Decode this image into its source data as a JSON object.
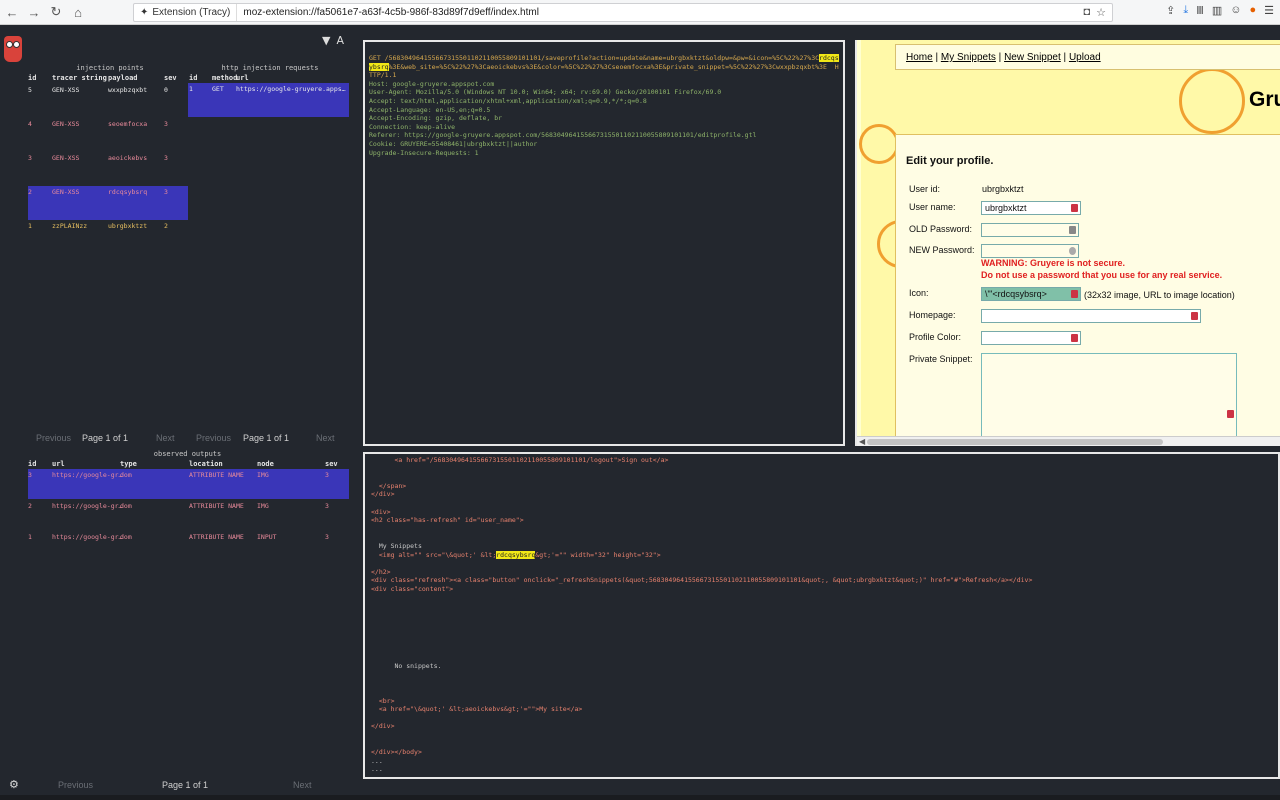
{
  "browser": {
    "identity": "Extension (Tracy)",
    "url": "moz-extension://fa5061e7-a63f-4c5b-986f-83d89f7d9eff/index.html"
  },
  "injection": {
    "title": "injection points",
    "headers": [
      "id",
      "tracer string",
      "payload",
      "sev"
    ],
    "rows": [
      {
        "id": "5",
        "tracer": "GEN-XSS",
        "payload": "wxxpbzqxbt",
        "sev": "0",
        "color": "white"
      },
      {
        "id": "4",
        "tracer": "GEN-XSS",
        "payload": "seoemfocxa",
        "sev": "3",
        "color": "pink"
      },
      {
        "id": "3",
        "tracer": "GEN-XSS",
        "payload": "aeoickebvs",
        "sev": "3",
        "color": "pink"
      },
      {
        "id": "2",
        "tracer": "GEN-XSS",
        "payload": "rdcqsybsrq",
        "sev": "3",
        "color": "pink",
        "selected": true
      },
      {
        "id": "1",
        "tracer": "zzPLAINzz",
        "payload": "ubrgbxktzt",
        "sev": "2",
        "color": "gold"
      }
    ],
    "pager": {
      "prev": "Previous",
      "page": "Page 1 of 1",
      "next": "Next"
    }
  },
  "requests": {
    "title": "http injection requests",
    "headers": [
      "id",
      "method",
      "url"
    ],
    "rows": [
      {
        "id": "1",
        "method": "GET",
        "url": "https://google-gruyere.appspot.com/"
      }
    ],
    "pager": {
      "prev": "Previous",
      "page": "Page 1 of 1",
      "next": "Next"
    }
  },
  "outputs": {
    "title": "observed outputs",
    "headers": [
      "id",
      "url",
      "type",
      "location",
      "node",
      "sev"
    ],
    "rows": [
      {
        "id": "3",
        "url": "https://google-gr…",
        "type": "dom",
        "location": "ATTRIBUTE NAME",
        "node": "IMG",
        "sev": "3",
        "selected": true
      },
      {
        "id": "2",
        "url": "https://google-gr…",
        "type": "dom",
        "location": "ATTRIBUTE NAME",
        "node": "IMG",
        "sev": "3"
      },
      {
        "id": "1",
        "url": "https://google-gr…",
        "type": "dom",
        "location": "ATTRIBUTE NAME",
        "node": "INPUT",
        "sev": "3"
      }
    ],
    "pager": {
      "prev": "Previous",
      "page": "Page 1 of 1",
      "next": "Next"
    }
  },
  "request_text": {
    "line1_before": "GET /568304964155667315501102110055809101101/saveprofile?action=update&name=ubrgbxktzt&oldpw=&pw=&icon=%5C%22%27%3C",
    "line1_hl": "rdcqsybsrq",
    "line1_after": "%3E&web_site=%5C%22%27%3Caeoickebvs%3E&color=%5C%22%27%3Cseoemfocxa%3E&private_snippet=%5C%22%27%3Cwxxpbzqxbt%3E  HTTP/1.1",
    "headers": [
      "Host: google-gruyere.appspot.com",
      "User-Agent: Mozilla/5.0 (Windows NT 10.0; Win64; x64; rv:69.0) Gecko/20100101 Firefox/69.0",
      "Accept: text/html,application/xhtml+xml,application/xml;q=0.9,*/*;q=0.8",
      "Accept-Language: en-US,en;q=0.5",
      "Accept-Encoding: gzip, deflate, br",
      "Connection: keep-alive",
      "Referer: https://google-gruyere.appspot.com/568304964155667315501102110055809101101/editprofile.gtl",
      "Cookie: GRUYERE=55408461|ubrgbxktzt||author",
      "Upgrade-Insecure-Requests: 1"
    ]
  },
  "response_text": {
    "l1": "      <a href=\"/568304964155667315501102110055809101101/logout\">Sign out</a>",
    "l2": "  </span>",
    "l3": "</div>",
    "l4": "<div>",
    "l5": "<h2 class=\"has-refresh\" id=\"user_name\">",
    "l6": "  My Snippets",
    "l7a": "  <img alt=\"\" src=\"\\&quot;' &lt;",
    "l7hl": "rdcqsybsrq",
    "l7b": "&gt;'=\"\" width=\"32\" height=\"32\">",
    "l8": "</h2>",
    "l9": "<div class=\"refresh\"><a class=\"button\" onclick=\"_refreshSnippets(&quot;568304964155667315501102110055809101101&quot;, &quot;ubrgbxktzt&quot;)\" href=\"#\">Refresh</a></div>",
    "l10": "<div class=\"content\">",
    "l11": "      No snippets.",
    "l12": "  <br>",
    "l13": "  <a href=\"\\&quot;' &lt;aeoickebvs&gt;'=\"\">My site</a>",
    "l14": "</div>",
    "l15": "</div></body>",
    "l16": "...",
    "l17": "..."
  },
  "gruyere": {
    "menu": {
      "home": "Home",
      "sep": "|",
      "my_snippets": "My Snippets",
      "new_snippet": "New Snippet",
      "upload": "Upload"
    },
    "title": "Gru",
    "heading": "Edit your profile.",
    "user_id_label": "User id:",
    "user_id_value": "ubrgbxktzt",
    "user_name_label": "User name:",
    "user_name_value": "ubrgbxktzt",
    "old_pw_label": "OLD Password:",
    "new_pw_label": "NEW Password:",
    "warning1": "WARNING: Gruyere is not secure.",
    "warning2": "Do not use a password that you use for any real service.",
    "icon_label": "Icon:",
    "icon_value": "\\\"'<rdcqsybsrq>",
    "icon_note": "(32x32 image, URL to image location)",
    "homepage_label": "Homepage:",
    "color_label": "Profile Color:",
    "snippet_label": "Private Snippet:"
  }
}
